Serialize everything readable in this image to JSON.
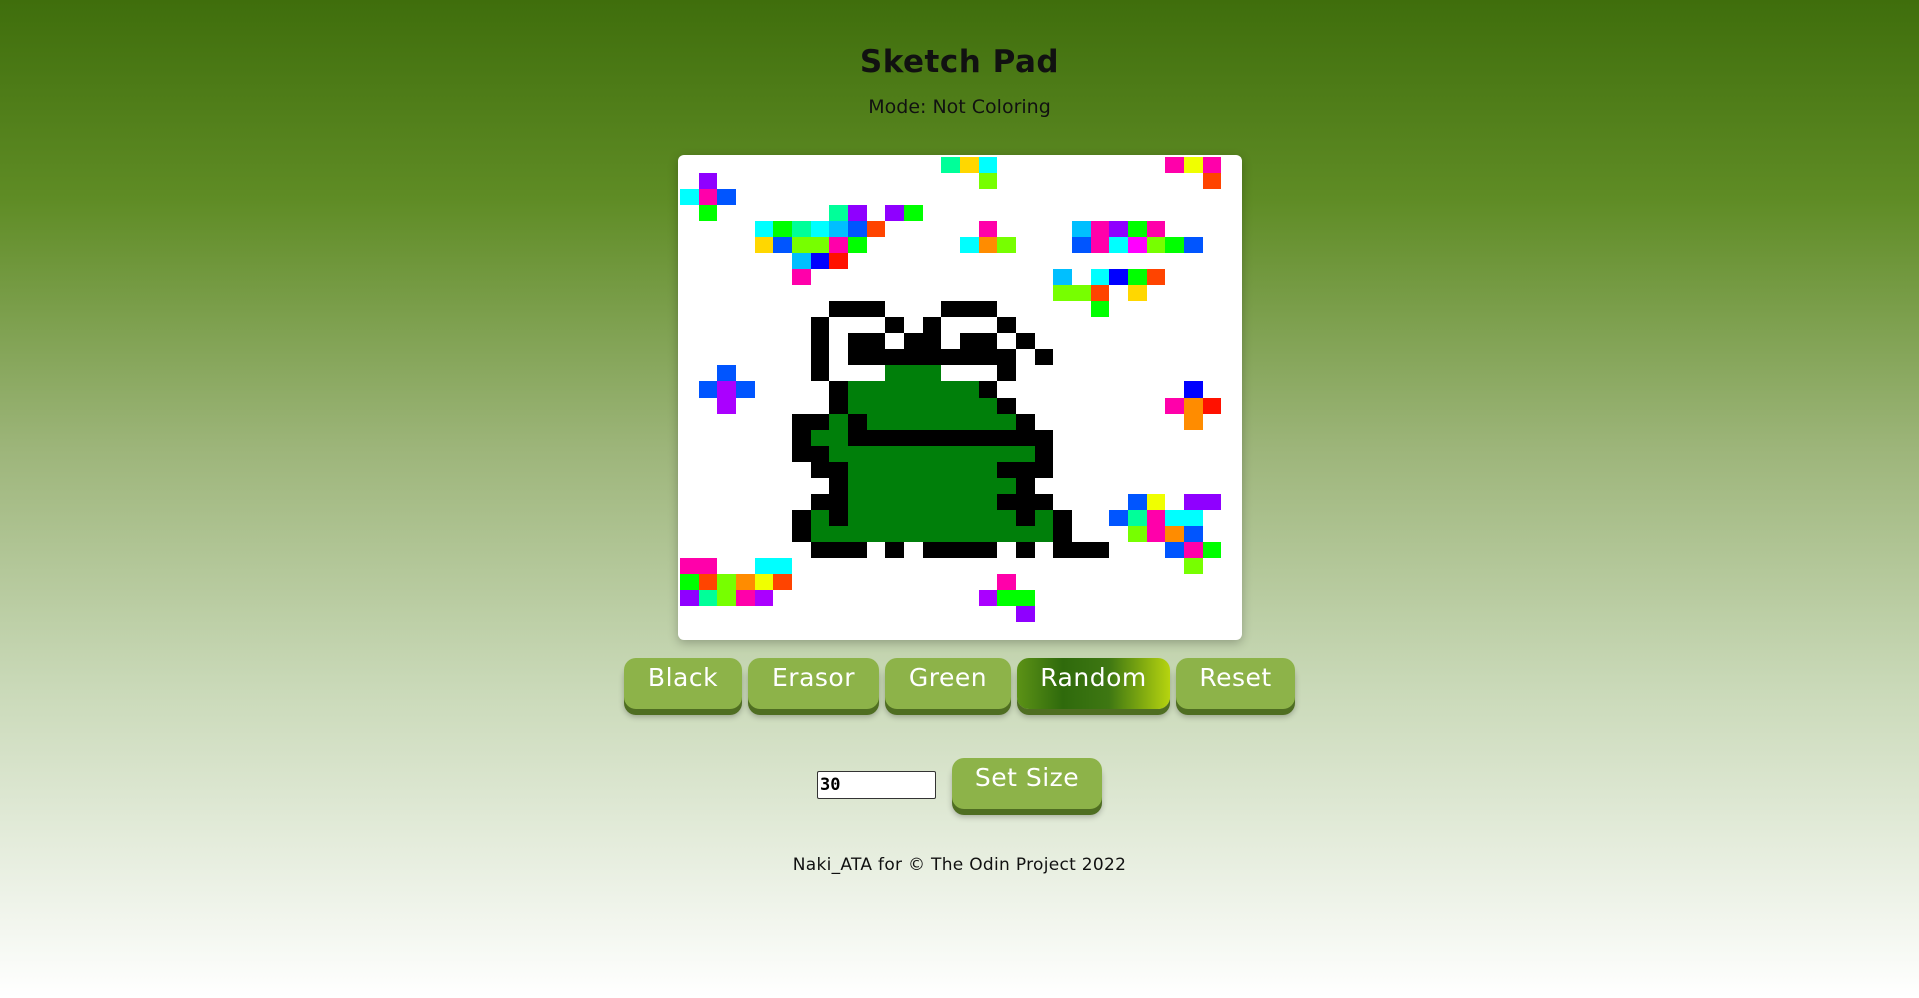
{
  "header": {
    "title": "Sketch Pad",
    "mode_text": "Mode: Not Coloring"
  },
  "grid": {
    "size": 30,
    "background": "#ffffff",
    "colors": {
      "K": "#000000",
      "G": "#007f0a",
      "W": "#ffffff",
      "c": "#00ffff",
      "m": "#ff00aa",
      "p": "#8f00ff",
      "b": "#0055ff",
      "u": "#0000ff",
      "g": "#00ff00",
      "l": "#77ff00",
      "o": "#ff8c00",
      "y": "#ffd700",
      "r": "#ff1100",
      "t": "#00ff99",
      "M": "#ff00ff",
      "s": "#00bfff",
      "e": "#ff4400",
      "Y": "#f0ff00",
      "P": "#aa00ff"
    },
    "rows": [
      "..............tyc.........mYm.",
      ".p..............l...........e.",
      "cmb...........................",
      ".g......tp.pg.................",
      "....cgtcsbe.....m....smpgm....",
      "....ybllmg.....col...bmcMlgb..",
      "......sur......................",
      "......m.............s.cuge.....",
      "....................lle y.....",
      "........KKK...KKK.....g.......",
      ".......KWWWK.KWWWK............",
      ".......KWKKWKKWKKWK...........",
      ".......KWKKKKKKKKKWK...........",
      "..b....KWWWGGGWWWK............",
      ".bPb....KGGGGGGGK..........u..",
      "..P.....KGGGGGGGGK........mor.",
      "......KKGKGGGGGGGGK........o..",
      "......KGGKKKKKKKKKKK..........",
      "......KKGGGGGGGGGGGK..........",
      ".......KKGGGGGGGGKKK..........",
      "........KGGGGGGGGGK...........",
      ".......KKGGGGGGGGKKK....bY.pp.",
      "......KGKGGGGGGGGGKGK..btmcc.",
      "......KGGGGGGGGGGGGGK...lmob.",
      ".......KKK.K.KKKK.K.KKK...bmg..",
      "mm..cc.....................l..",
      "geloYe...........m............",
      "ptlmP...........Pgg...........",
      "..................p...........",
      ".............................."
    ]
  },
  "buttons": {
    "black": "Black",
    "erasor": "Erasor",
    "green": "Green",
    "random": "Random",
    "reset": "Reset"
  },
  "size_control": {
    "value": "30",
    "set_label": "Set Size"
  },
  "footer": {
    "text": "Naki_ATA for © The Odin Project 2022"
  }
}
